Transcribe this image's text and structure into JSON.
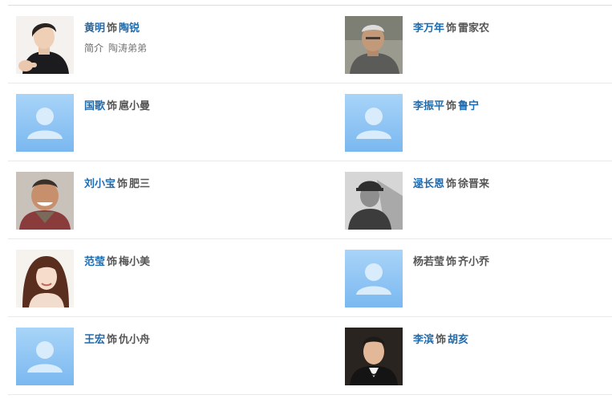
{
  "cast": [
    {
      "left": {
        "actor": "黄明",
        "sep": "饰",
        "role": "陶锐",
        "intro_label": "简介",
        "intro_value": "陶涛弟弟",
        "photo": "photo-young-man-black-scarf",
        "actor_link": true,
        "role_link": true
      },
      "right": {
        "actor": "李万年",
        "sep": "饰",
        "role": "雷家农",
        "photo": "photo-older-man-grey",
        "actor_link": true,
        "role_link": false
      }
    },
    {
      "left": {
        "actor": "国歌",
        "sep": "饰",
        "role": "扈小曼",
        "photo": "avatar-placeholder",
        "actor_link": true,
        "role_link": false
      },
      "right": {
        "actor": "李振平",
        "sep": "饰",
        "role": "鲁宁",
        "photo": "avatar-placeholder",
        "actor_link": true,
        "role_link": true
      }
    },
    {
      "left": {
        "actor": "刘小宝",
        "sep": "饰",
        "role": "肥三",
        "photo": "photo-bald-man-smiling",
        "actor_link": true,
        "role_link": false
      },
      "right": {
        "actor": "逯长恩",
        "sep": "饰",
        "role": "徐晋来",
        "photo": "photo-man-cap-bw",
        "actor_link": true,
        "role_link": false
      }
    },
    {
      "left": {
        "actor": "范莹",
        "sep": "饰",
        "role": "梅小美",
        "photo": "photo-young-woman",
        "actor_link": true,
        "role_link": false
      },
      "right": {
        "actor": "杨若莹",
        "sep": "饰",
        "role": "齐小乔",
        "photo": "avatar-placeholder",
        "actor_link": false,
        "role_link": false
      }
    },
    {
      "left": {
        "actor": "王宏",
        "sep": "饰",
        "role": "仇小舟",
        "photo": "avatar-placeholder",
        "actor_link": true,
        "role_link": false
      },
      "right": {
        "actor": "李滨",
        "sep": "饰",
        "role": "胡亥",
        "photo": "photo-man-tuxedo",
        "actor_link": true,
        "role_link": true
      }
    }
  ],
  "colors": {
    "link": "#1e6bb0",
    "text": "#555555",
    "divider": "#e9e9e9",
    "placeholder_top": "#a8d4f8",
    "placeholder_bottom": "#7ab8f0"
  }
}
